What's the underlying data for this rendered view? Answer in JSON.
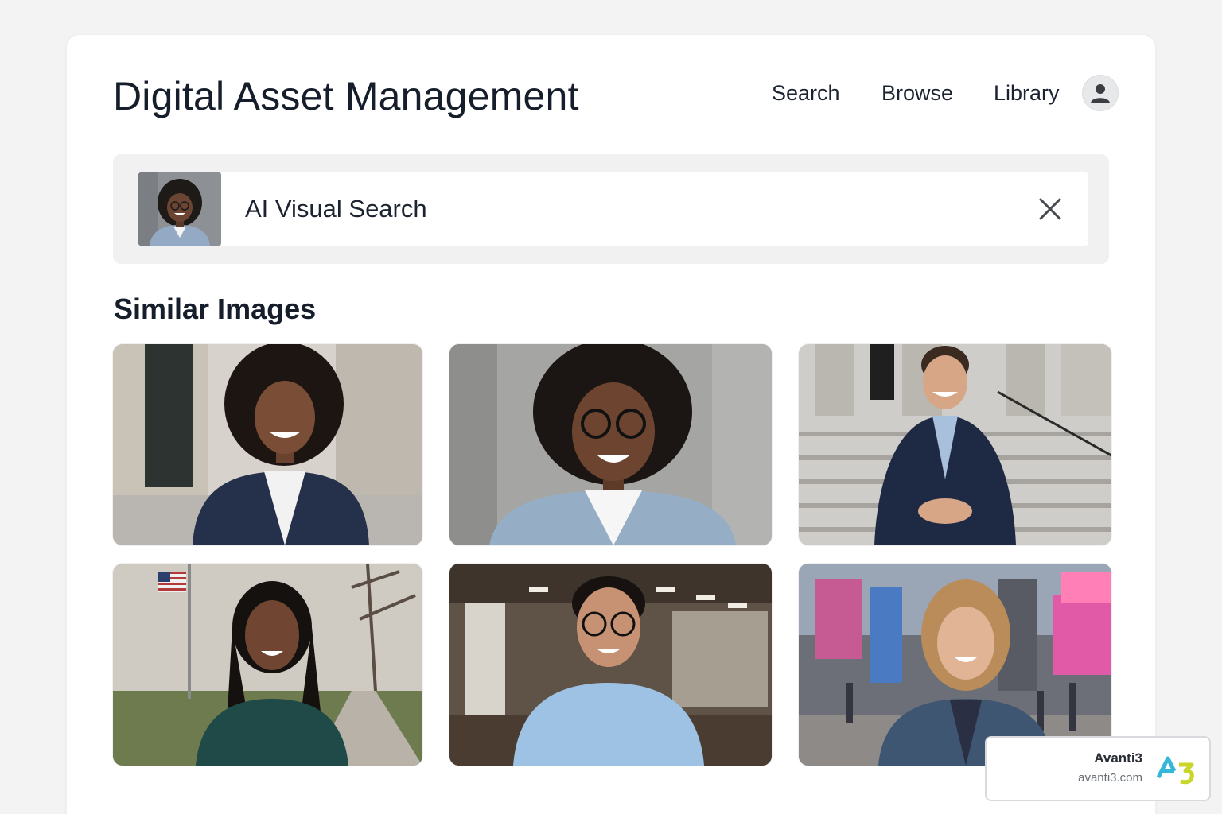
{
  "app": {
    "title": "Digital Asset Management"
  },
  "nav": {
    "items": [
      {
        "label": "Search"
      },
      {
        "label": "Browse"
      },
      {
        "label": "Library"
      }
    ]
  },
  "search": {
    "value": "AI Visual Search"
  },
  "results": {
    "heading": "Similar Images",
    "items": [
      {
        "subject": "woman in navy blazer, city street"
      },
      {
        "subject": "woman with glasses, grey background"
      },
      {
        "subject": "man in navy suit on steps"
      },
      {
        "subject": "woman in green shirt, park with flag"
      },
      {
        "subject": "man with glasses, office"
      },
      {
        "subject": "woman in denim jacket, city square"
      }
    ]
  },
  "badge": {
    "name": "Avanti3",
    "url": "avanti3.com",
    "logo_text": "A3"
  },
  "colors": {
    "accent_cyan": "#35b7d8",
    "accent_lime": "#c8d62a",
    "text_dark": "#161d2b"
  }
}
